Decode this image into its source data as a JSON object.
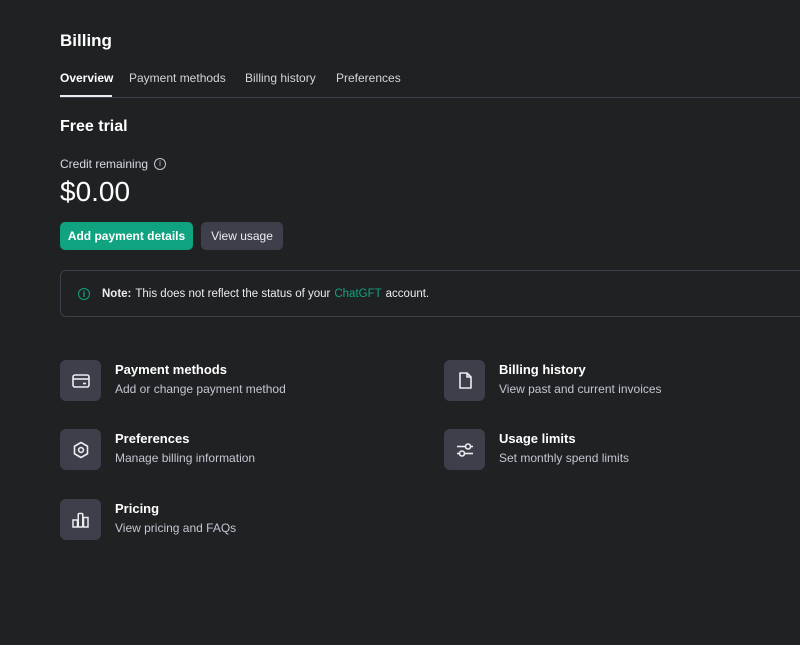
{
  "header": {
    "title": "Billing"
  },
  "tabs": [
    "Overview",
    "Payment methods",
    "Billing history",
    "Preferences"
  ],
  "overview": {
    "section_title": "Free trial",
    "credit_label": "Credit remaining",
    "credit_value": "$0.00",
    "add_payment_label": "Add payment details",
    "view_usage_label": "View usage"
  },
  "note": {
    "label": "Note:",
    "text_before": "This does not reflect the status of your",
    "link": "ChatGFT",
    "text_after": "account."
  },
  "cards": [
    {
      "title": "Payment methods",
      "desc": "Add or change payment method",
      "icon": "credit-card-icon"
    },
    {
      "title": "Billing history",
      "desc": "View past and current invoices",
      "icon": "document-icon"
    },
    {
      "title": "Preferences",
      "desc": "Manage billing information",
      "icon": "gear-icon"
    },
    {
      "title": "Usage limits",
      "desc": "Set monthly spend limits",
      "icon": "sliders-icon"
    },
    {
      "title": "Pricing",
      "desc": "View pricing and FAQs",
      "icon": "bar-chart-icon"
    }
  ],
  "colors": {
    "background": "#202123",
    "accent": "#10a37f",
    "tile": "#3e3f4b"
  }
}
